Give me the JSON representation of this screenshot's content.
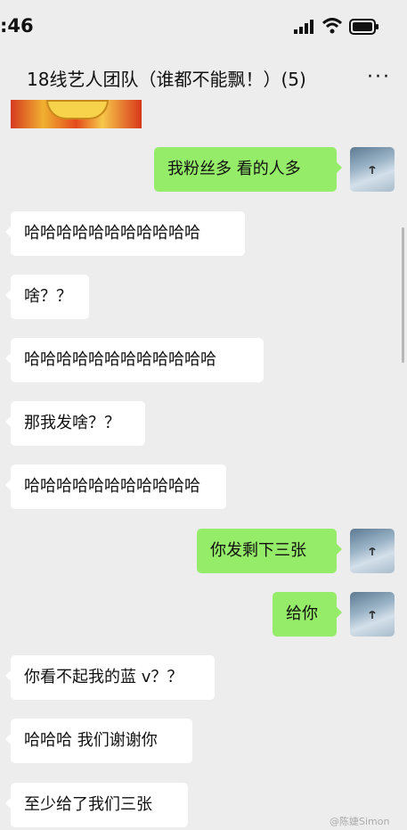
{
  "status_bar": {
    "time": ":46"
  },
  "header": {
    "title": "18线艺人团队（谁都不能飘！）(5)",
    "more_icon": "···"
  },
  "messages": [
    {
      "side": "out",
      "text": "我粉丝多 看的人多"
    },
    {
      "side": "in",
      "text": "哈哈哈哈哈哈哈哈哈哈哈"
    },
    {
      "side": "in",
      "text": "啥？？"
    },
    {
      "side": "in",
      "text": "哈哈哈哈哈哈哈哈哈哈哈哈"
    },
    {
      "side": "in",
      "text": "那我发啥？？"
    },
    {
      "side": "in",
      "text": "哈哈哈哈哈哈哈哈哈哈哈"
    },
    {
      "side": "out",
      "text": "你发剩下三张"
    },
    {
      "side": "out",
      "text": "给你"
    },
    {
      "side": "in",
      "text": "你看不起我的蓝 v？？"
    },
    {
      "side": "in",
      "text": "哈哈哈 我们谢谢你"
    },
    {
      "side": "in",
      "text": "至少给了我们三张"
    }
  ],
  "watermark": "@陈婕Simon",
  "colors": {
    "background": "#ededed",
    "incoming_bubble": "#ffffff",
    "outgoing_bubble": "#95ec69"
  }
}
